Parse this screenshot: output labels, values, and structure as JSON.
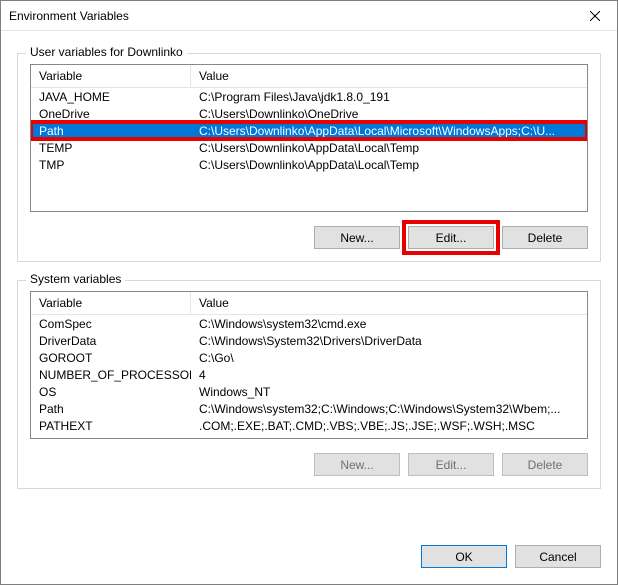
{
  "title": "Environment Variables",
  "user_group": {
    "label": "User variables for Downlinko",
    "columns": {
      "variable": "Variable",
      "value": "Value"
    },
    "rows": [
      {
        "variable": "JAVA_HOME",
        "value": "C:\\Program Files\\Java\\jdk1.8.0_191"
      },
      {
        "variable": "OneDrive",
        "value": "C:\\Users\\Downlinko\\OneDrive"
      },
      {
        "variable": "Path",
        "value": "C:\\Users\\Downlinko\\AppData\\Local\\Microsoft\\WindowsApps;C:\\U..."
      },
      {
        "variable": "TEMP",
        "value": "C:\\Users\\Downlinko\\AppData\\Local\\Temp"
      },
      {
        "variable": "TMP",
        "value": "C:\\Users\\Downlinko\\AppData\\Local\\Temp"
      }
    ],
    "selected_index": 2,
    "buttons": {
      "new": "New...",
      "edit": "Edit...",
      "delete": "Delete"
    }
  },
  "system_group": {
    "label": "System variables",
    "columns": {
      "variable": "Variable",
      "value": "Value"
    },
    "rows": [
      {
        "variable": "ComSpec",
        "value": "C:\\Windows\\system32\\cmd.exe"
      },
      {
        "variable": "DriverData",
        "value": "C:\\Windows\\System32\\Drivers\\DriverData"
      },
      {
        "variable": "GOROOT",
        "value": "C:\\Go\\"
      },
      {
        "variable": "NUMBER_OF_PROCESSORS",
        "value": "4"
      },
      {
        "variable": "OS",
        "value": "Windows_NT"
      },
      {
        "variable": "Path",
        "value": "C:\\Windows\\system32;C:\\Windows;C:\\Windows\\System32\\Wbem;..."
      },
      {
        "variable": "PATHEXT",
        "value": ".COM;.EXE;.BAT;.CMD;.VBS;.VBE;.JS;.JSE;.WSF;.WSH;.MSC"
      }
    ],
    "buttons": {
      "new": "New...",
      "edit": "Edit...",
      "delete": "Delete"
    }
  },
  "footer": {
    "ok": "OK",
    "cancel": "Cancel"
  }
}
